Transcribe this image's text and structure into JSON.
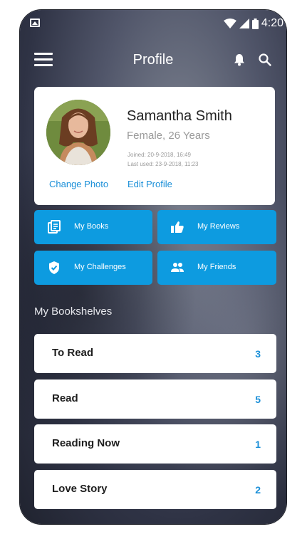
{
  "status_bar": {
    "time": "4:20",
    "icons": [
      "image-icon",
      "wifi-icon",
      "signal-icon",
      "battery-icon"
    ]
  },
  "header": {
    "title": "Profile",
    "icons": [
      "menu-icon",
      "bell-icon",
      "search-icon"
    ]
  },
  "profile": {
    "name": "Samantha Smith",
    "subtitle": "Female, 26 Years",
    "joined": "Joined: 20-9-2018, 16:49",
    "last_used": "Last used: 23-9-2018, 11:23",
    "change_photo": "Change Photo",
    "edit_profile": "Edit Profile"
  },
  "actions": [
    {
      "label": "My Books",
      "icon": "book-icon"
    },
    {
      "label": "My Reviews",
      "icon": "thumbs-up-icon"
    },
    {
      "label": "My Challenges",
      "icon": "shield-check-icon"
    },
    {
      "label": "My Friends",
      "icon": "people-icon"
    }
  ],
  "bookshelves": {
    "title": "My Bookshelves",
    "items": [
      {
        "name": "To Read",
        "count": "3"
      },
      {
        "name": "Read",
        "count": "5"
      },
      {
        "name": "Reading Now",
        "count": "1"
      },
      {
        "name": "Love Story",
        "count": "2"
      }
    ]
  },
  "colors": {
    "accent": "#0d9be0",
    "link": "#1a8fd8",
    "card": "#ffffff"
  }
}
